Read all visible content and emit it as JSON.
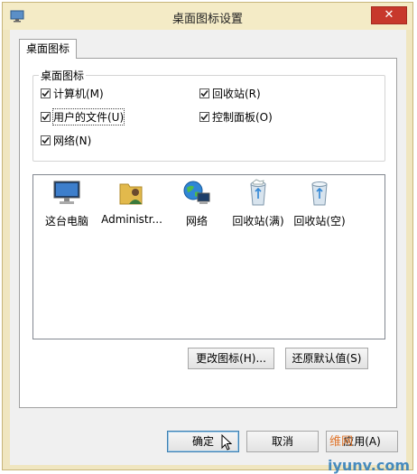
{
  "window": {
    "title": "桌面图标设置",
    "close_label": "✕"
  },
  "tabs": [
    {
      "label": "桌面图标"
    }
  ],
  "desktop_icons_group": {
    "label": "桌面图标",
    "checkboxes": [
      {
        "label": "计算机(M)",
        "checked": true
      },
      {
        "label": "回收站(R)",
        "checked": true
      },
      {
        "label": "用户的文件(U)",
        "checked": true
      },
      {
        "label": "控制面板(O)",
        "checked": true
      },
      {
        "label": "网络(N)",
        "checked": true
      }
    ]
  },
  "icons": [
    {
      "label": "这台电脑",
      "icon": "computer-icon"
    },
    {
      "label": "Administr...",
      "icon": "user-folder-icon"
    },
    {
      "label": "网络",
      "icon": "network-globe-icon"
    },
    {
      "label": "回收站(满)",
      "icon": "recycle-bin-full-icon"
    },
    {
      "label": "回收站(空)",
      "icon": "recycle-bin-empty-icon"
    }
  ],
  "buttons": {
    "change_icon": "更改图标(H)...",
    "restore_default": "还原默认值(S)",
    "ok": "确定",
    "cancel": "取消",
    "apply": "应用(A)"
  },
  "watermark": {
    "text": "iyunv.com",
    "text2": "维网"
  },
  "colors": {
    "frame": "#f0e6c0",
    "close": "#c7382c",
    "default_border": "#3c7fb1"
  }
}
